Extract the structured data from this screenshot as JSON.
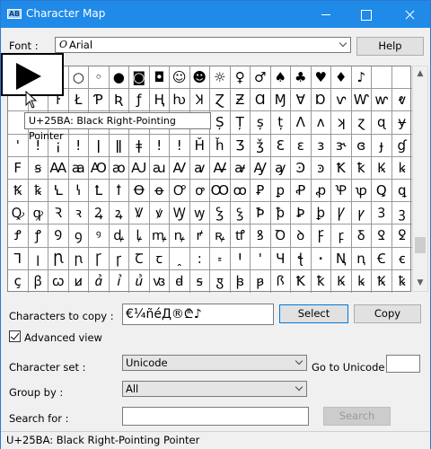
{
  "window": {
    "title": "Character Map",
    "app_icon": "AB"
  },
  "font_row": {
    "label": "Font :",
    "font_icon": "O",
    "selected_font": "Arial",
    "help_label": "Help"
  },
  "grid": {
    "rows": [
      [
        "",
        "",
        "◆",
        "○",
        "◦",
        "●",
        "◙",
        "◘",
        "☺",
        "☻",
        "☼",
        "♀",
        "♂",
        "♠",
        "♣",
        "♥",
        "♦",
        "♪",
        "",
        ""
      ],
      [
        "",
        "",
        "ŀ",
        "Ł",
        "Ƥ",
        "Ʀ",
        "ƒ",
        "Ⱨ",
        "ƕ",
        "Ʞ",
        "Ɀ",
        "Ƶ",
        "Ɑ",
        "Ɱ",
        "Ɐ",
        "Ɒ",
        "ⱱ",
        "Ⱳ",
        "ⱳ",
        "ⱴ"
      ],
      [
        "",
        "",
        "",
        "",
        "",
        "",
        "",
        "",
        "ȷ",
        "ı",
        "Ș",
        "Ț",
        "ș",
        "ț",
        "Ʌ",
        "ʌ",
        "ʞ",
        "ɀ",
        "ɋ",
        "ɏ"
      ],
      [
        "'",
        "!",
        "¡",
        "ǃ",
        "ǀ",
        "ǁ",
        "ǂ",
        "ǃ",
        "ǃ",
        "Ȟ",
        "ȟ",
        "Ʒ",
        "ǯ",
        "Ɛ",
        "ɛ",
        "ɜ",
        "ɝ",
        "ɞ",
        "ɟ",
        "ɠ"
      ],
      [
        "F",
        "ꞩ",
        "Ꜳ",
        "ꜳ",
        "Ꜵ",
        "ꜵ",
        "Ꜷ",
        "ꜷ",
        "Ꜹ",
        "ꜹ",
        "Ꜻ",
        "ꜻ",
        "Ꜽ",
        "ꜽ",
        "Ꜿ",
        "ꜿ",
        "Ꝁ",
        "ꝁ",
        "Ꝃ",
        "ꝃ"
      ],
      [
        "Ꝅ",
        "ꝅ",
        "Ꝇ",
        "ꝇ",
        "Ꝉ",
        "ꝉ",
        "Ꝋ",
        "ꝋ",
        "Ꝍ",
        "ꝍ",
        "Ꝏ",
        "ꝏ",
        "Ꝑ",
        "ꝑ",
        "Ꝓ",
        "ꝓ",
        "Ꝕ",
        "ꝕ",
        "Ꝗ",
        "ꝗ"
      ],
      [
        "Ꝙ",
        "ꝙ",
        "Ꝛ",
        "ꝛ",
        "Ꝝ",
        "ꝝ",
        "Ꝟ",
        "ꝟ",
        "Ꝡ",
        "ꝡ",
        "Ꝣ",
        "ꝣ",
        "Ꝥ",
        "ꝥ",
        "Ꝧ",
        "ꝧ",
        "Ꝩ",
        "ꝩ",
        "Ꝫ",
        "ꝫ"
      ],
      [
        "Ꝭ",
        "ꝭ",
        "Ꝯ",
        "ꝯ",
        "ꝰ",
        "ꝱ",
        "ꝲ",
        "ꝳ",
        "ꝴ",
        "ꝵ",
        "ꝶ",
        "ꝷ",
        "ꝸ",
        "Ꝺ",
        "ꝺ",
        "Ꝼ",
        "ꝼ",
        "Ᵹ",
        "Ꝿ",
        "ꝿ"
      ],
      [
        "Ꞁ",
        "ꞁ",
        "Ꞃ",
        "ꞃ",
        "Ꞅ",
        "ꞅ",
        "Ꞇ",
        "ꞇ",
        "ꞈ",
        "꞉",
        "꞊",
        "Ꞌ",
        "ꞌ",
        "Ɥ",
        "ꞎ",
        "ꞏ",
        "Ꞑ",
        "ꞑ",
        "Ꞓ",
        "ꞓ"
      ],
      [
        "ç",
        "ꞵ",
        "ꞷ",
        "ꞹ",
        "ꞻ",
        "ꞽ",
        "ꞿ",
        "ꟃ",
        "ꟈ",
        "ꟊ",
        "ꟑ",
        "ꟓ",
        "ꟕ",
        "ꟗ",
        "Ꝁ",
        "ꝁ",
        "Ꝃ",
        "ꝃ",
        "Ꝅ",
        "ꝅ"
      ]
    ]
  },
  "zoom": {
    "glyph_name": "black-right-pointing-pointer"
  },
  "tooltip": {
    "text": "U+25BA: Black Right-Pointing Pointer"
  },
  "copy_row": {
    "label": "Characters to copy :",
    "value": "€¼ñéД®₾♪",
    "select_label": "Select",
    "copy_label": "Copy"
  },
  "advanced": {
    "label": "Advanced view",
    "checked": true
  },
  "charset_row": {
    "label": "Character set :",
    "value": "Unicode",
    "goto_label": "Go to Unicode :",
    "goto_value": ""
  },
  "groupby_row": {
    "label": "Group by :",
    "value": "All"
  },
  "search_row": {
    "label": "Search for :",
    "value": "",
    "button_label": "Search"
  },
  "status": {
    "text": "U+25BA: Black Right-Pointing Pointer"
  }
}
